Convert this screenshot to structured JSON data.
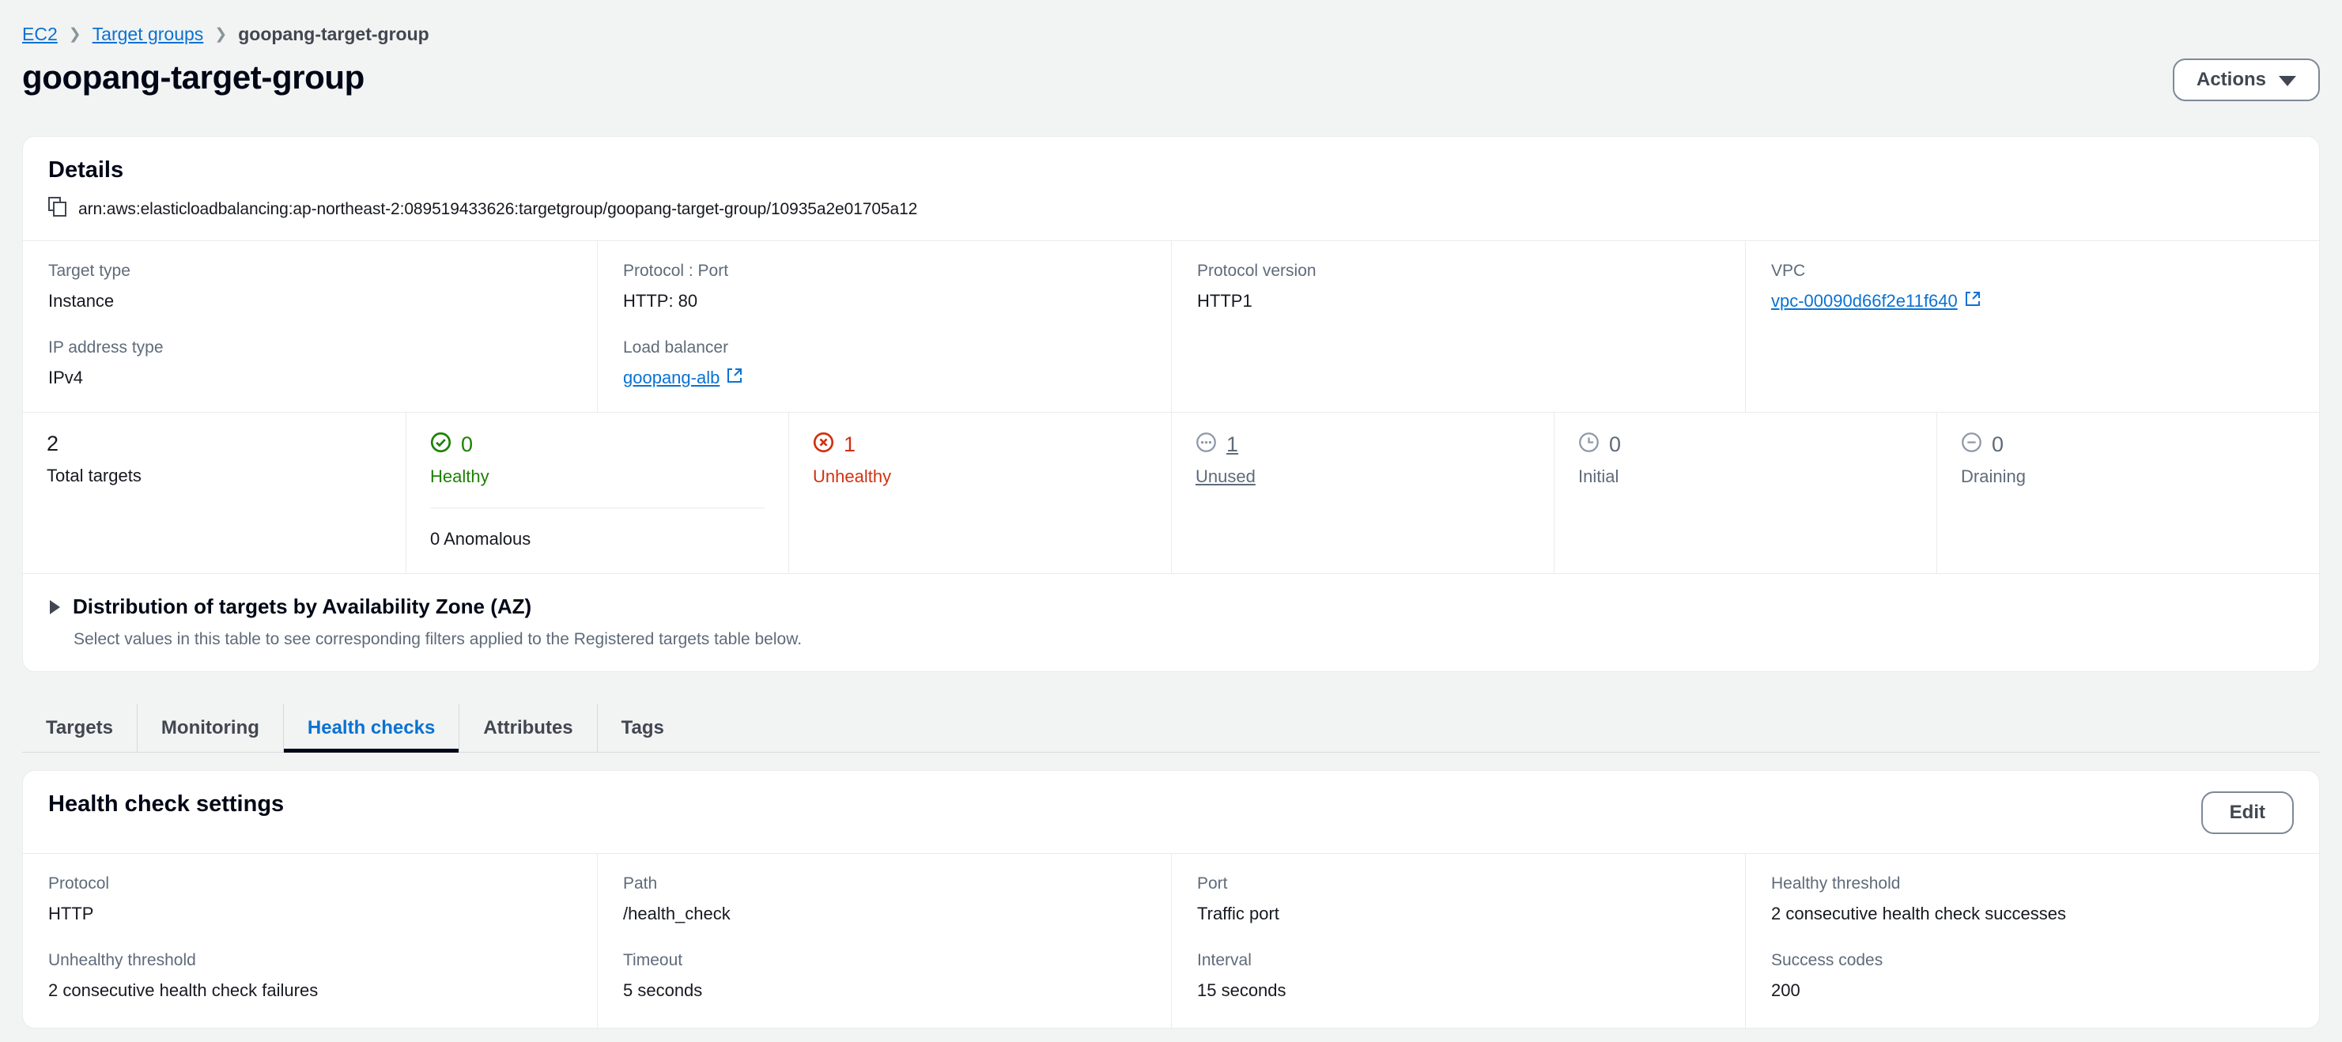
{
  "breadcrumb": {
    "items": [
      {
        "label": "EC2",
        "link": true
      },
      {
        "label": "Target groups",
        "link": true
      },
      {
        "label": "goopang-target-group",
        "link": false
      }
    ],
    "separator": "❯"
  },
  "header": {
    "title": "goopang-target-group",
    "actions_label": "Actions"
  },
  "details": {
    "title": "Details",
    "arn": "arn:aws:elasticloadbalancing:ap-northeast-2:089519433626:targetgroup/goopang-target-group/10935a2e01705a12",
    "copy_icon": "copy-icon",
    "fields": [
      {
        "label": "Target type",
        "value": "Instance"
      },
      {
        "label": "IP address type",
        "value": "IPv4"
      },
      {
        "label": "Protocol : Port",
        "value": "HTTP: 80"
      },
      {
        "label": "Load balancer",
        "value": "goopang-alb",
        "is_link": true
      },
      {
        "label": "Protocol version",
        "value": "HTTP1"
      },
      {
        "label": "VPC",
        "value": "vpc-00090d66f2e11f640",
        "is_link": true
      }
    ],
    "external_link_icon": "external-link-icon"
  },
  "status": {
    "items": [
      {
        "count": "2",
        "label": "Total targets",
        "icon": "none",
        "color": "#16191f",
        "count_link": false
      },
      {
        "count": "0",
        "label": "Healthy",
        "icon": "check-circle-icon",
        "color": "#1d8102",
        "count_link": false,
        "sub": "0 Anomalous"
      },
      {
        "count": "1",
        "label": "Unhealthy",
        "icon": "x-circle-icon",
        "color": "#d13212",
        "count_link": false
      },
      {
        "count": "1",
        "label": "Unused",
        "icon": "ellipsis-circle-icon",
        "color": "#5f6b7a",
        "count_link": true
      },
      {
        "count": "0",
        "label": "Initial",
        "icon": "clock-circle-icon",
        "color": "#5f6b7a",
        "count_link": false
      },
      {
        "count": "0",
        "label": "Draining",
        "icon": "minus-circle-icon",
        "color": "#5f6b7a",
        "count_link": false
      }
    ]
  },
  "distribution": {
    "title": "Distribution of targets by Availability Zone (AZ)",
    "description": "Select values in this table to see corresponding filters applied to the Registered targets table below.",
    "expanded": false,
    "toggle_icon": "triangle-right-icon"
  },
  "tabs": [
    {
      "label": "Targets",
      "active": false
    },
    {
      "label": "Monitoring",
      "active": false
    },
    {
      "label": "Health checks",
      "active": true
    },
    {
      "label": "Attributes",
      "active": false
    },
    {
      "label": "Tags",
      "active": false
    }
  ],
  "health_checks": {
    "title": "Health check settings",
    "edit_label": "Edit",
    "fields": [
      {
        "label": "Protocol",
        "value": "HTTP"
      },
      {
        "label": "Unhealthy threshold",
        "value": "2 consecutive health check failures"
      },
      {
        "label": "Path",
        "value": "/health_check"
      },
      {
        "label": "Timeout",
        "value": "5 seconds"
      },
      {
        "label": "Port",
        "value": "Traffic port"
      },
      {
        "label": "Interval",
        "value": "15 seconds"
      },
      {
        "label": "Healthy threshold",
        "value": "2 consecutive health check successes"
      },
      {
        "label": "Success codes",
        "value": "200"
      }
    ]
  },
  "colors": {
    "accent_link": "#0972d3",
    "healthy_green": "#1d8102",
    "unhealthy_red": "#d13212",
    "muted_gray": "#5f6b7a",
    "page_bg": "#f2f3f3",
    "card_bg": "#ffffff",
    "border": "#e9ebed"
  }
}
